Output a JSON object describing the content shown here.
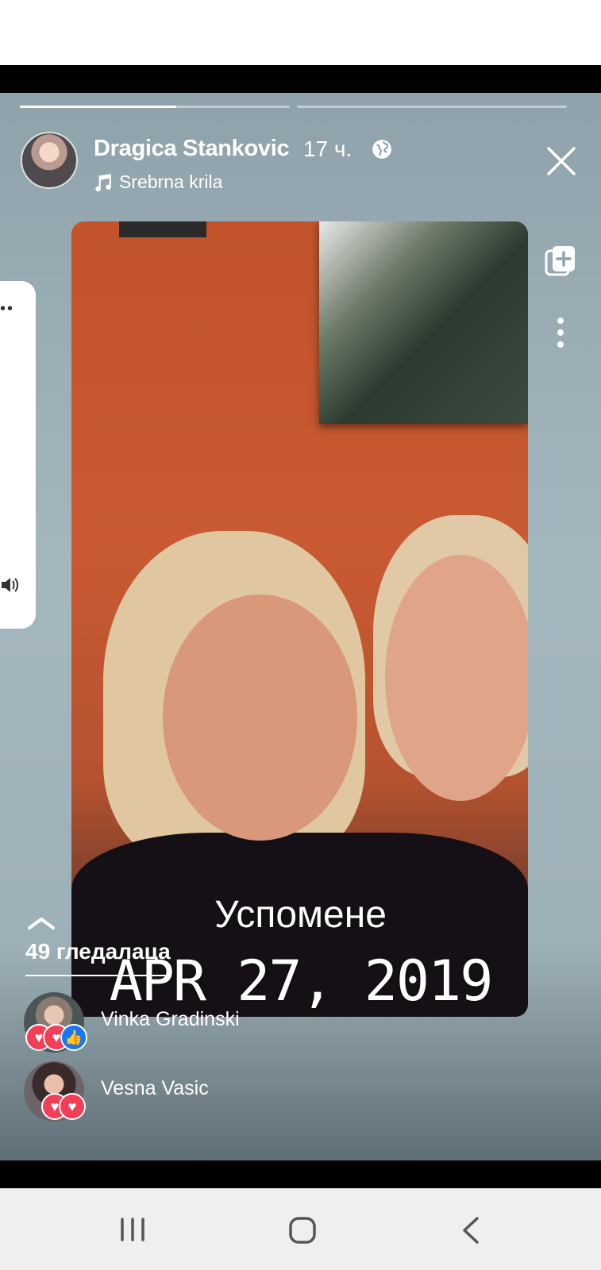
{
  "story": {
    "author": "Dragica Stankovic",
    "time": "17 ч.",
    "song": "Srebrna krila",
    "progress": [
      0.58,
      0.0
    ],
    "overlay_title": "Успомене",
    "overlay_date": "APR 27, 2019"
  },
  "viewers": {
    "count_label": "49 гледалаца",
    "list": [
      {
        "name": "Vinka Gradinski",
        "reactions": [
          "heart-icon",
          "care-icon",
          "like-icon"
        ]
      },
      {
        "name": "Vesna Vasic",
        "reactions": [
          "heart-icon",
          "care-icon"
        ]
      }
    ]
  },
  "colors": {
    "accent_heart": "#f33e58",
    "accent_like": "#1877f2",
    "care": "#f7b125"
  }
}
